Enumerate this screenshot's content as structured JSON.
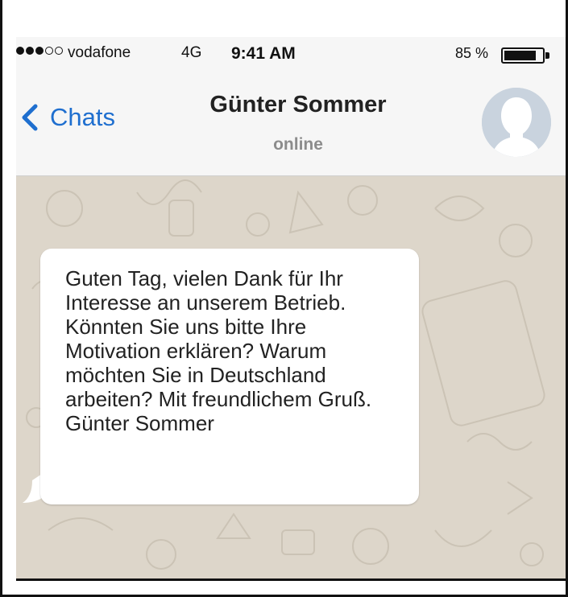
{
  "status_bar": {
    "signal_dots": "●●●○○",
    "carrier": "vodafone",
    "network": "4G",
    "time": "9:41 AM",
    "battery_percent": "85 %",
    "battery_level": 0.85
  },
  "nav": {
    "back_label": "Chats",
    "contact_name": "Günter Sommer",
    "contact_status": "online",
    "back_icon": "chevron-left-icon",
    "avatar_icon": "person-silhouette-icon"
  },
  "messages": [
    {
      "direction": "incoming",
      "text": "Guten Tag, vielen Dank für Ihr Interesse an unserem Betrieb. Könnten Sie uns bitte Ihre Motivation erklären? Warum möchten Sie in Deutschland arbeiten? Mit freundlichem Gruß. Günter Sommer"
    }
  ],
  "colors": {
    "accent": "#1f6fcf",
    "chat_background": "#ddd6ca",
    "bubble": "#ffffff",
    "header_background": "#f6f6f6"
  }
}
